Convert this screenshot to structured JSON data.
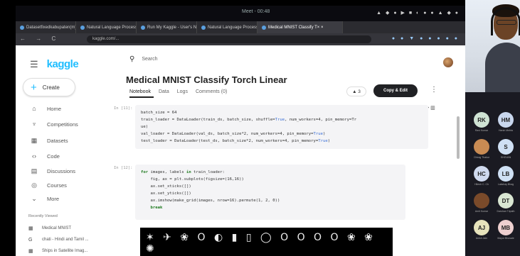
{
  "os_bar": {
    "title": "Meet - 00:48",
    "tray": "▲ ◆ ● ▶ ■ ◐ ● ● ▲ ◆ ●"
  },
  "tabs": [
    {
      "label": "Datasetfixedkabupaten(m)",
      "active": false
    },
    {
      "label": "Natural Language Processin",
      "active": false
    },
    {
      "label": "Run My Kaggle - User's Ne",
      "active": false
    },
    {
      "label": "Natural Language Processin",
      "active": false
    },
    {
      "label": "Medical MNIST Classify T× ×",
      "active": true
    }
  ],
  "address": {
    "nav": "← → C",
    "url": "kaggle.com/...",
    "ext": "● ● ▼ ● ● ● ● ●"
  },
  "sidebar": {
    "logo": "kaggle",
    "create_label": "Create",
    "items": [
      {
        "icon": "⌂",
        "label": "Home"
      },
      {
        "icon": "♆",
        "label": "Competitions"
      },
      {
        "icon": "▦",
        "label": "Datasets"
      },
      {
        "icon": "‹›",
        "label": "Code"
      },
      {
        "icon": "▤",
        "label": "Discussions"
      },
      {
        "icon": "◎",
        "label": "Courses"
      },
      {
        "icon": "⌄",
        "label": "More"
      }
    ],
    "recent_title": "Recently Viewed",
    "recent": [
      {
        "icon": "▦",
        "label": "Medical MNIST"
      },
      {
        "icon": "G",
        "label": "chati - Hindi and Tamil ..."
      },
      {
        "icon": "▦",
        "label": "Ships in Satellite Imag..."
      }
    ]
  },
  "search": {
    "placeholder": "Search"
  },
  "notebook": {
    "title": "Medical MNIST Classify Torch Linear",
    "tabs": [
      "Notebook",
      "Data",
      "Logs",
      "Comments (0)"
    ],
    "vote": "▲ 3",
    "copy_edit": "Copy & Edit",
    "more": "⋮",
    "cell_tool": "<> ▥"
  },
  "cells": [
    {
      "label": "In [11]:",
      "lines": [
        "batch_size = 64",
        "train_loader = DataLoader(train_ds, batch_size, shuffle=True, num_workers=4, pin_memory=Tr",
        "ue)",
        "val_loader = DataLoader(val_ds, batch_size*2, num_workers=4, pin_memory=True)",
        "test_loader = DataLoader(test_ds, batch_size*2, num_workers=4, pin_memory=True)"
      ]
    },
    {
      "label": "In [12]:",
      "lines": [
        "for images, labels in train_loader:",
        "    fig, ax = plt.subplots(figsize=(16,16))",
        "    ax.set_xticks([])",
        "    ax.set_yticks([])",
        "    ax.imshow(make_grid(images, nrow=16).permute(1, 2, 0))",
        "    break"
      ]
    }
  ],
  "image_output": {
    "glyphs": "✶ ✈ ❀ O ◐ ▮ ▯ ◯ O O O O ❀ ❀ ✺"
  },
  "meeting": {
    "participants": [
      {
        "initials": "RK",
        "name": "Ravi Kumar",
        "color": "#cfe3d4"
      },
      {
        "initials": "HM",
        "name": "Harsh Mehta",
        "color": "#c9d7ee"
      },
      {
        "initials": "",
        "name": "Chirag Thakur",
        "color": "#c98b53"
      },
      {
        "initials": "S",
        "name": "SHOVAN",
        "color": "#cfe0f4"
      },
      {
        "initials": "HC",
        "name": "Hitesh C. Ch",
        "color": "#cfd9ee"
      },
      {
        "initials": "LB",
        "name": "Lakshay Bhag",
        "color": "#cfe0f4"
      },
      {
        "initials": "",
        "name": "Amit Kumar",
        "color": "#7a4a2a"
      },
      {
        "initials": "DT",
        "name": "Darshan Tripath",
        "color": "#d9e6d2"
      },
      {
        "initials": "AJ",
        "name": "Anish Jain",
        "color": "#e7e3bc"
      },
      {
        "initials": "MB",
        "name": "Mayur Bhosale",
        "color": "#eed0d0"
      }
    ]
  }
}
